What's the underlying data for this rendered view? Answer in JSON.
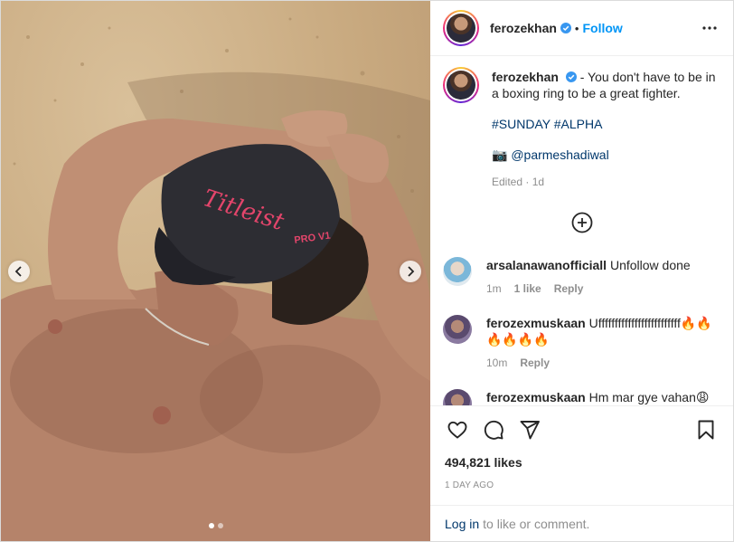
{
  "post": {
    "username": "ferozekhan",
    "follow_label": "Follow",
    "separator": "•",
    "caption": "You don't have to be in a boxing ring to be a great fighter.",
    "caption_dash": "-",
    "hashtags": "#SUNDAY #ALPHA",
    "credit_icon": "📷",
    "credit_handle": "@parmeshadiwal",
    "edited_label": "Edited",
    "edited_time": "1d",
    "cap_text": "Titleist",
    "cap_text2": "PRO V1"
  },
  "comments": [
    {
      "username": "arsalanawanofficiall",
      "text": "Unfollow done",
      "time": "1m",
      "likes": "1 like",
      "reply": "Reply"
    },
    {
      "username": "ferozexmuskaan",
      "text": "Ufffffffffffffffffffffffff🔥🔥🔥🔥🔥🔥",
      "time": "10m",
      "reply": "Reply"
    },
    {
      "username": "ferozexmuskaan",
      "text": "Hm mar gye vahan😩"
    }
  ],
  "footer": {
    "likes": "494,821 likes",
    "date": "1 DAY AGO",
    "login_link": "Log in",
    "login_text": "to like or comment."
  },
  "icons": {
    "verified": "verified-badge-icon",
    "more": "more-options-icon",
    "add": "add-comment-icon",
    "like": "heart-icon",
    "comment": "comment-icon",
    "share": "share-icon",
    "save": "bookmark-icon"
  },
  "colors": {
    "follow": "#0095f6",
    "verified": "#3897f0",
    "link": "#00376b",
    "muted": "#8e8e8e"
  }
}
